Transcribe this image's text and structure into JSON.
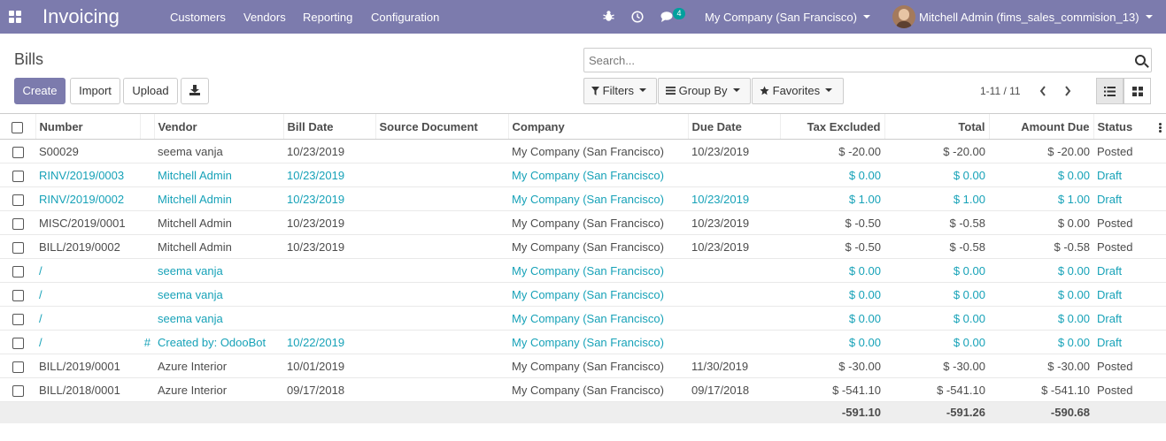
{
  "navbar": {
    "app_title": "Invoicing",
    "menu": [
      "Customers",
      "Vendors",
      "Reporting",
      "Configuration"
    ],
    "messages_badge": "4",
    "company": "My Company (San Francisco)",
    "user": "Mitchell Admin (fims_sales_commision_13)"
  },
  "control_panel": {
    "breadcrumb": "Bills",
    "search_placeholder": "Search...",
    "buttons": {
      "create": "Create",
      "import": "Import",
      "upload": "Upload"
    },
    "filters": {
      "filters": "Filters",
      "group_by": "Group By",
      "favorites": "Favorites"
    },
    "pager": "1-11 / 11"
  },
  "table": {
    "columns": {
      "number": "Number",
      "vendor": "Vendor",
      "bill_date": "Bill Date",
      "source_document": "Source Document",
      "company": "Company",
      "due_date": "Due Date",
      "tax_excluded": "Tax Excluded",
      "total": "Total",
      "amount_due": "Amount Due",
      "status": "Status"
    },
    "rows": [
      {
        "number": "S00029",
        "hash": "",
        "vendor": "seema vanja",
        "bill_date": "10/23/2019",
        "source": "",
        "company": "My Company (San Francisco)",
        "due_date": "10/23/2019",
        "tax_excluded": "$ -20.00",
        "total": "$ -20.00",
        "amount_due": "$ -20.00",
        "status": "Posted"
      },
      {
        "number": "RINV/2019/0003",
        "hash": "",
        "vendor": "Mitchell Admin",
        "bill_date": "10/23/2019",
        "source": "",
        "company": "My Company (San Francisco)",
        "due_date": "",
        "tax_excluded": "$ 0.00",
        "total": "$ 0.00",
        "amount_due": "$ 0.00",
        "status": "Draft"
      },
      {
        "number": "RINV/2019/0002",
        "hash": "",
        "vendor": "Mitchell Admin",
        "bill_date": "10/23/2019",
        "source": "",
        "company": "My Company (San Francisco)",
        "due_date": "10/23/2019",
        "tax_excluded": "$ 1.00",
        "total": "$ 1.00",
        "amount_due": "$ 1.00",
        "status": "Draft"
      },
      {
        "number": "MISC/2019/0001",
        "hash": "",
        "vendor": "Mitchell Admin",
        "bill_date": "10/23/2019",
        "source": "",
        "company": "My Company (San Francisco)",
        "due_date": "10/23/2019",
        "tax_excluded": "$ -0.50",
        "total": "$ -0.58",
        "amount_due": "$ 0.00",
        "status": "Posted"
      },
      {
        "number": "BILL/2019/0002",
        "hash": "",
        "vendor": "Mitchell Admin",
        "bill_date": "10/23/2019",
        "source": "",
        "company": "My Company (San Francisco)",
        "due_date": "10/23/2019",
        "tax_excluded": "$ -0.50",
        "total": "$ -0.58",
        "amount_due": "$ -0.58",
        "status": "Posted"
      },
      {
        "number": "/",
        "hash": "",
        "vendor": "seema vanja",
        "bill_date": "",
        "source": "",
        "company": "My Company (San Francisco)",
        "due_date": "",
        "tax_excluded": "$ 0.00",
        "total": "$ 0.00",
        "amount_due": "$ 0.00",
        "status": "Draft"
      },
      {
        "number": "/",
        "hash": "",
        "vendor": "seema vanja",
        "bill_date": "",
        "source": "",
        "company": "My Company (San Francisco)",
        "due_date": "",
        "tax_excluded": "$ 0.00",
        "total": "$ 0.00",
        "amount_due": "$ 0.00",
        "status": "Draft"
      },
      {
        "number": "/",
        "hash": "",
        "vendor": "seema vanja",
        "bill_date": "",
        "source": "",
        "company": "My Company (San Francisco)",
        "due_date": "",
        "tax_excluded": "$ 0.00",
        "total": "$ 0.00",
        "amount_due": "$ 0.00",
        "status": "Draft"
      },
      {
        "number": "/",
        "hash": "#",
        "vendor": "Created by: OdooBot",
        "bill_date": "10/22/2019",
        "source": "",
        "company": "My Company (San Francisco)",
        "due_date": "",
        "tax_excluded": "$ 0.00",
        "total": "$ 0.00",
        "amount_due": "$ 0.00",
        "status": "Draft"
      },
      {
        "number": "BILL/2019/0001",
        "hash": "",
        "vendor": "Azure Interior",
        "bill_date": "10/01/2019",
        "source": "",
        "company": "My Company (San Francisco)",
        "due_date": "11/30/2019",
        "tax_excluded": "$ -30.00",
        "total": "$ -30.00",
        "amount_due": "$ -30.00",
        "status": "Posted"
      },
      {
        "number": "BILL/2018/0001",
        "hash": "",
        "vendor": "Azure Interior",
        "bill_date": "09/17/2018",
        "source": "",
        "company": "My Company (San Francisco)",
        "due_date": "09/17/2018",
        "tax_excluded": "$ -541.10",
        "total": "$ -541.10",
        "amount_due": "$ -541.10",
        "status": "Posted"
      }
    ],
    "totals": {
      "tax_excluded": "-591.10",
      "total": "-591.26",
      "amount_due": "-590.68"
    }
  },
  "colors": {
    "brand": "#7c7bad",
    "draft_text": "#17a2b8",
    "badge": "#00a09d"
  }
}
